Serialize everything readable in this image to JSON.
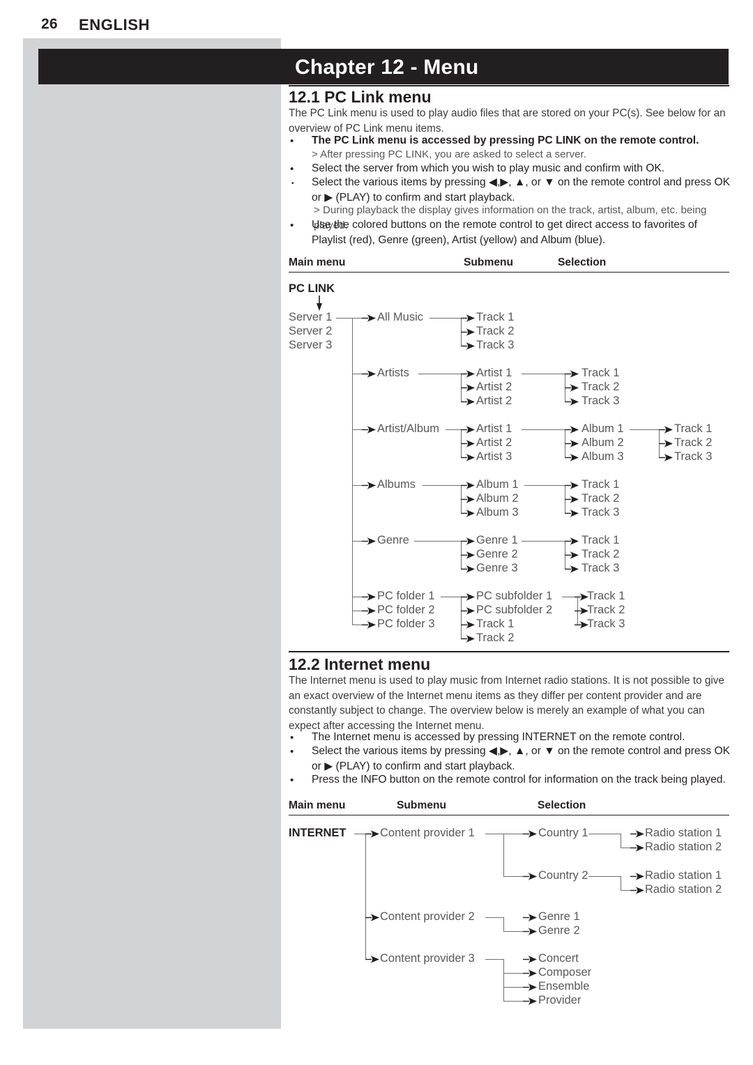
{
  "page": {
    "number": "26",
    "language": "ENGLISH",
    "chapter_title": "Chapter 12 - Menu",
    "colors": {
      "sidebar_gray": "#d2d3d4",
      "bar_black": "#231f20",
      "node_gray": "#58585b",
      "line_gray": "#6d6e71"
    }
  },
  "sections": [
    {
      "id": "pc_link",
      "heading": "12.1 PC Link menu",
      "intro": "The PC  Link  menu is used to play audio files that are stored on your PC(s). See below for an overview of PC Link menu items.",
      "bullets": [
        {
          "text": "The PC Link menu is accessed by pressing PC LINK on the remote control.",
          "sub": "> After pressing PC LINK, you are asked to select a server."
        },
        {
          "text": "Select the server from which you wish to play music and confirm with OK.",
          "sub": null
        },
        {
          "text": "Select the various items by pressing ◀,▶, ▲, or ▼ on the remote control and press OK or ▶ (PLAY) to confirm and start playback.",
          "sub": "> During playback the display gives information on the track, artist, album, etc. being played."
        },
        {
          "text": "Use the colored buttons on the remote control to get direct access to favorites of Playlist (red), Genre (green), Artist (yellow) and Album (blue).",
          "sub": null
        }
      ]
    },
    {
      "id": "internet",
      "heading": "12.2 Internet menu",
      "intro": "The Internet menu is used to play music from Internet radio stations. It is not possible to give an exact overview of the Internet menu items as they differ per content provider and are constantly subject to change. The overview below is merely an example of what you can expect after accessing the Internet menu.",
      "bullets": [
        {
          "text": "The Internet menu is accessed by pressing INTERNET on the remote control.",
          "sub": null
        },
        {
          "text": "Select the various items by pressing ◀,▶, ▲, or ▼ on the remote control and press OK or ▶ (PLAY) to confirm and start playback.",
          "sub": null
        },
        {
          "text": "Press the INFO button on the remote control for information on the track being played.",
          "sub": null
        }
      ]
    }
  ],
  "diagram_pc_link": {
    "columns": [
      "Main menu",
      "Submenu",
      "Selection"
    ],
    "root": "PC LINK",
    "servers": [
      "Server 1",
      "Server 2",
      "Server 3"
    ],
    "branches": [
      {
        "label": "All Music",
        "children": [
          "Track 1",
          "Track 2",
          "Track 3"
        ]
      },
      {
        "label": "Artists",
        "children": [
          "Artist 1",
          "Artist 2",
          "Artist 2"
        ],
        "grandchildren": [
          "Track 1",
          "Track 2",
          "Track 3"
        ]
      },
      {
        "label": "Artist/Album",
        "children": [
          "Artist 1",
          "Artist 2",
          "Artist 3"
        ],
        "grandchildren": [
          "Album 1",
          "Album 2",
          "Album 3"
        ],
        "greatgrandchildren": [
          "Track 1",
          "Track 2",
          "Track 3"
        ]
      },
      {
        "label": "Albums",
        "children": [
          "Album 1",
          "Album 2",
          "Album 3"
        ],
        "grandchildren": [
          "Track 1",
          "Track 2",
          "Track 3"
        ]
      },
      {
        "label": "Genre",
        "children": [
          "Genre 1",
          "Genre 2",
          "Genre 3"
        ],
        "grandchildren": [
          "Track 1",
          "Track 2",
          "Track 3"
        ]
      }
    ],
    "folders": [
      "PC folder 1",
      "PC folder 2",
      "PC folder 3"
    ],
    "folder_children": [
      "PC subfolder 1",
      "PC subfolder 2",
      "Track 1",
      "Track 2"
    ],
    "folder_grandchildren": [
      "Track 1",
      "Track 2",
      "Track 3"
    ]
  },
  "diagram_internet": {
    "columns": [
      "Main menu",
      "Submenu",
      "Selection"
    ],
    "root": "INTERNET",
    "providers": [
      {
        "label": "Content provider 1",
        "children": [
          {
            "label": "Country 1",
            "items": [
              "Radio station 1",
              "Radio station 2"
            ]
          },
          {
            "label": "Country 2",
            "items": [
              "Radio station 1",
              "Radio station 2"
            ]
          }
        ]
      },
      {
        "label": "Content provider 2",
        "children": [
          {
            "label": "Genre 1",
            "items": []
          },
          {
            "label": "Genre 2",
            "items": []
          }
        ]
      },
      {
        "label": "Content provider 3",
        "children": [
          {
            "label": "Concert",
            "items": []
          },
          {
            "label": "Composer",
            "items": []
          },
          {
            "label": "Ensemble",
            "items": []
          },
          {
            "label": "Provider",
            "items": []
          }
        ]
      }
    ]
  }
}
